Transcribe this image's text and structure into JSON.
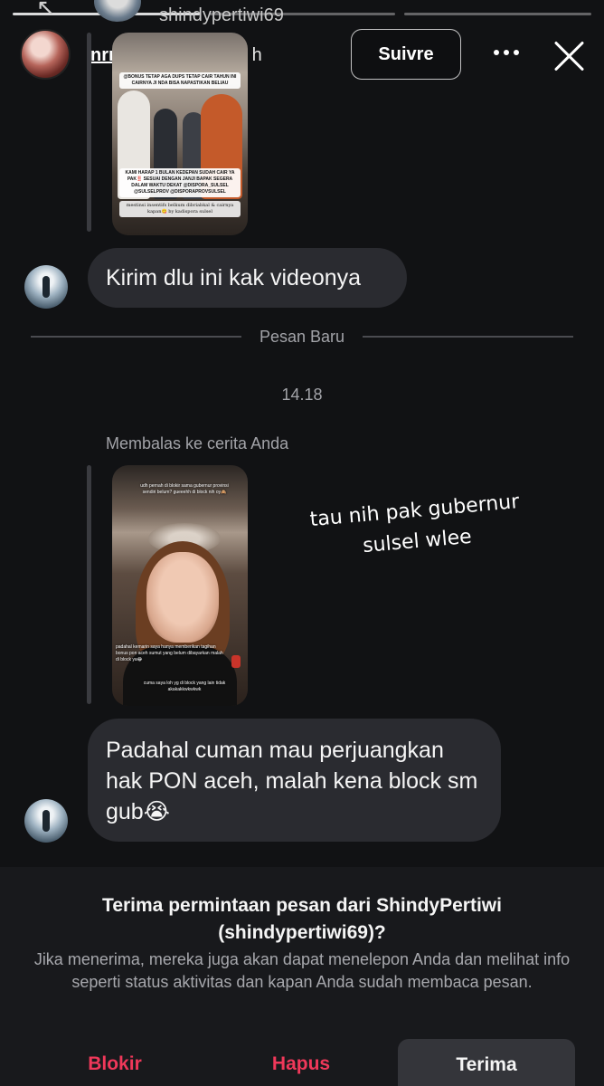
{
  "story_header": {
    "previous_username": "shindypertiwi69",
    "username": "nrrizkafauziah",
    "time_ago": "4 h",
    "follow_label": "Suivre"
  },
  "thread": {
    "story_reply_1": {
      "caption_top": "@BONUS TETAP AGA DUPS TETAP CAIR TAHUN INI CAIRNYA JI NDA BISA NAPASTIKAN BELIAU",
      "caption_mid": "KAMI HARAP 1 BULAN KEDEPAN SUDAH CAIR YA PAK‼️ SESUAI DENGAN JANJI BAPAK SEGERA DALAM WAKTU DEKAT @DISPORA_SULSEL @SULSELPROV @DISPORAPROVSULSEL",
      "caption_bottom": "mestinsi insentifs belkum dibriabkal & cairnya kapan😋 by kadispora sulsel"
    },
    "message_1": "Kirim dlu ini kak videonya",
    "new_messages_divider": "Pesan Baru",
    "timestamp": "14.18",
    "reply_label": "Membalas ke cerita Anda",
    "story_reply_2": {
      "text_top": "udh pernah di blokir sama gubernur provinsi sendiri belum? gueeehh di block nih oy🙈",
      "text_mid": "padahal kemarin saya hanya memberikan tagihan bonus pon aceh sumut yang belum dibayarkan malah di block ya😂",
      "text_bottom": "cuma saya loh yg di block yang lain tidak akakakkwkwkwk"
    },
    "sticker_text": "tau nih pak gubernur sulsel wlee",
    "message_2": "Padahal cuman mau perjuangkan hak PON aceh, malah kena block sm gub😭"
  },
  "request_panel": {
    "title": "Terima permintaan pesan dari ShindyPertiwi (shindypertiwi69)?",
    "description": "Jika menerima, mereka juga akan dapat menelepon Anda dan melihat info seperti status aktivitas dan kapan Anda sudah membaca pesan.",
    "block_label": "Blokir",
    "delete_label": "Hapus",
    "accept_label": "Terima"
  },
  "colors": {
    "background": "#111214",
    "bubble": "#2a2b30",
    "danger": "#f0385a",
    "muted_text": "#a2a3a8"
  }
}
